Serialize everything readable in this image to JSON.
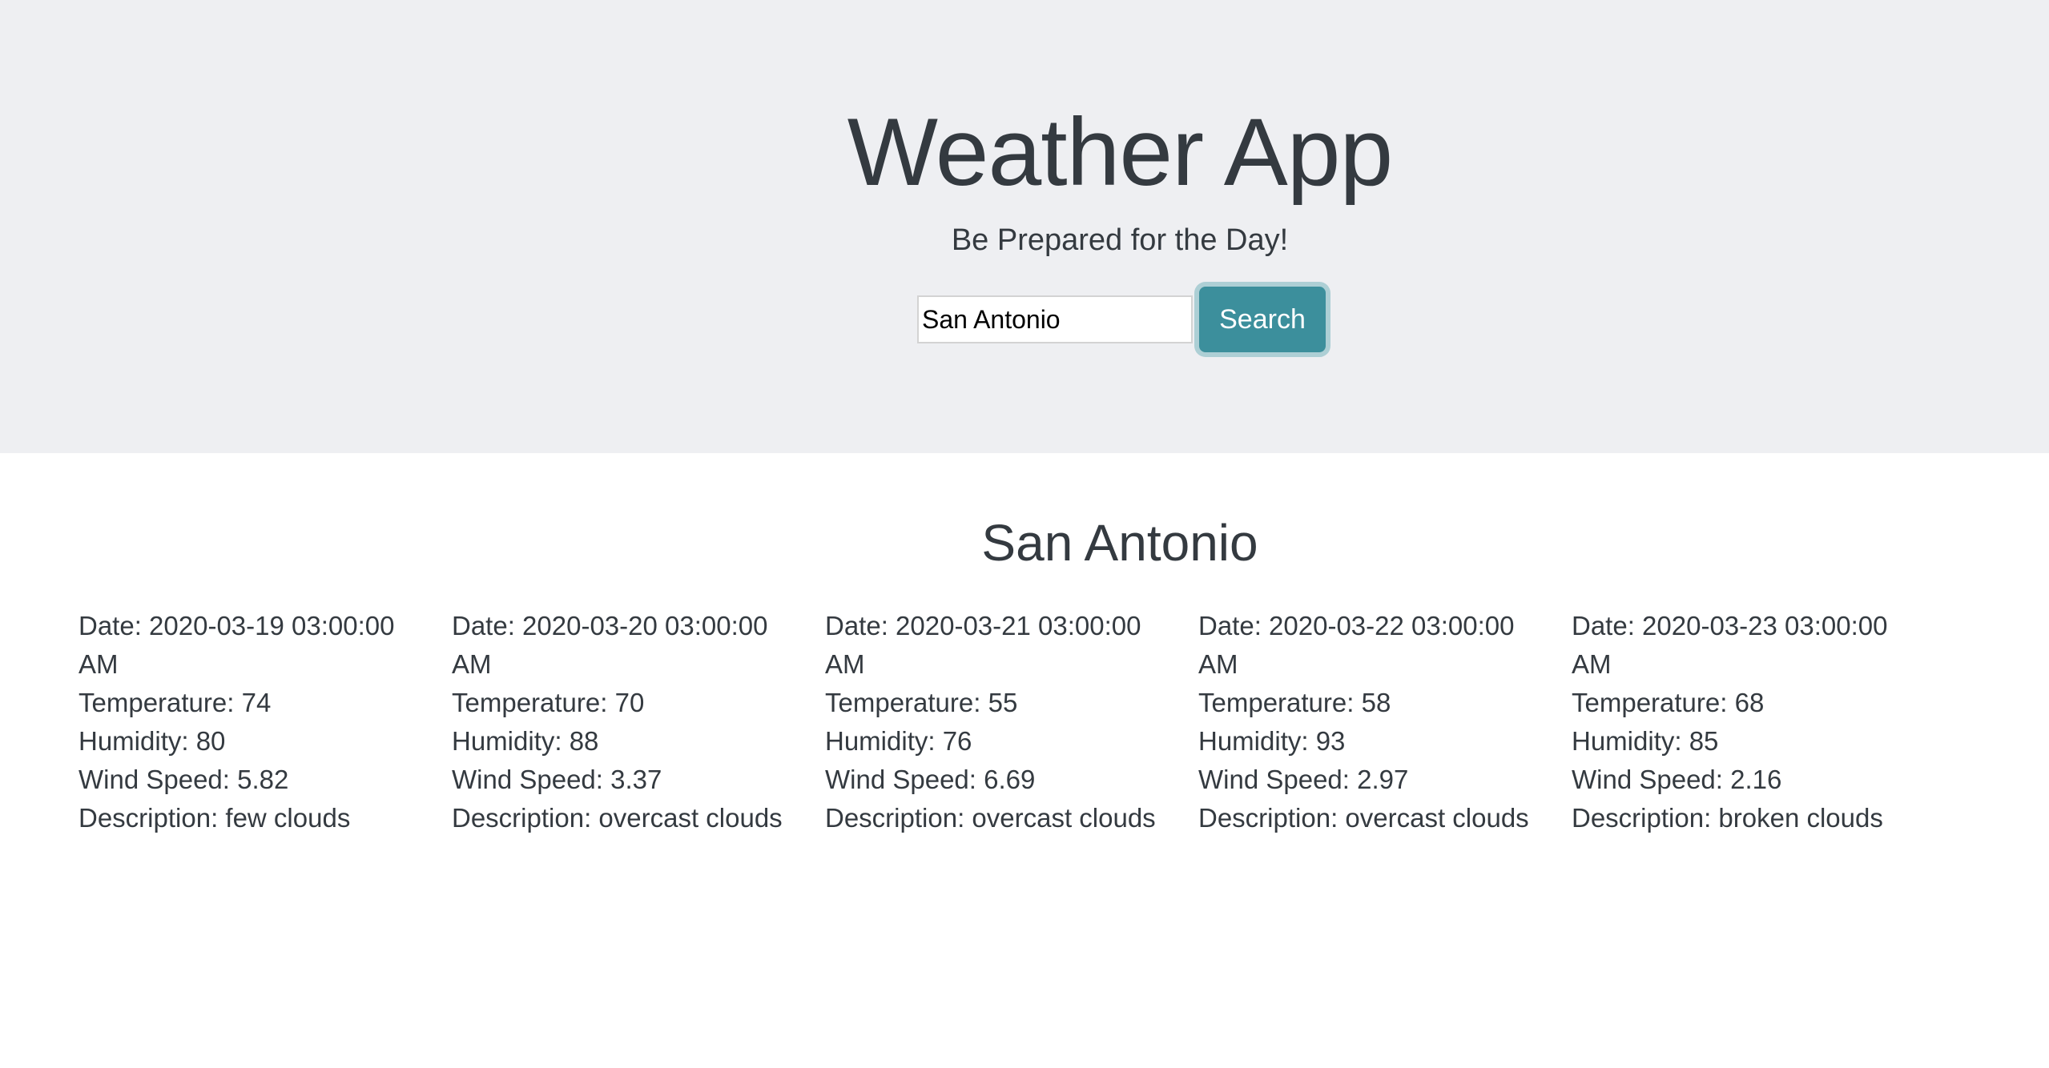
{
  "header": {
    "title": "Weather App",
    "subtitle": "Be Prepared for the Day!"
  },
  "search": {
    "value": "San Antonio",
    "button_label": "Search"
  },
  "results": {
    "city": "San Antonio",
    "days": [
      {
        "date": "Date: 2020-03-19 03:00:00 AM",
        "temperature": "Temperature: 74",
        "humidity": "Humidity: 80",
        "wind": "Wind Speed: 5.82",
        "description": "Description: few clouds"
      },
      {
        "date": "Date: 2020-03-20 03:00:00 AM",
        "temperature": "Temperature: 70",
        "humidity": "Humidity: 88",
        "wind": "Wind Speed: 3.37",
        "description": "Description: overcast clouds"
      },
      {
        "date": "Date: 2020-03-21 03:00:00 AM",
        "temperature": "Temperature: 55",
        "humidity": "Humidity: 76",
        "wind": "Wind Speed: 6.69",
        "description": "Description: overcast clouds"
      },
      {
        "date": "Date: 2020-03-22 03:00:00 AM",
        "temperature": "Temperature: 58",
        "humidity": "Humidity: 93",
        "wind": "Wind Speed: 2.97",
        "description": "Description: overcast clouds"
      },
      {
        "date": "Date: 2020-03-23 03:00:00 AM",
        "temperature": "Temperature: 68",
        "humidity": "Humidity: 85",
        "wind": "Wind Speed: 2.16",
        "description": "Description: broken clouds"
      }
    ]
  },
  "colors": {
    "jumbotron_bg": "#eeeff2",
    "button_bg": "#3c8f9c",
    "text": "#343a40"
  }
}
